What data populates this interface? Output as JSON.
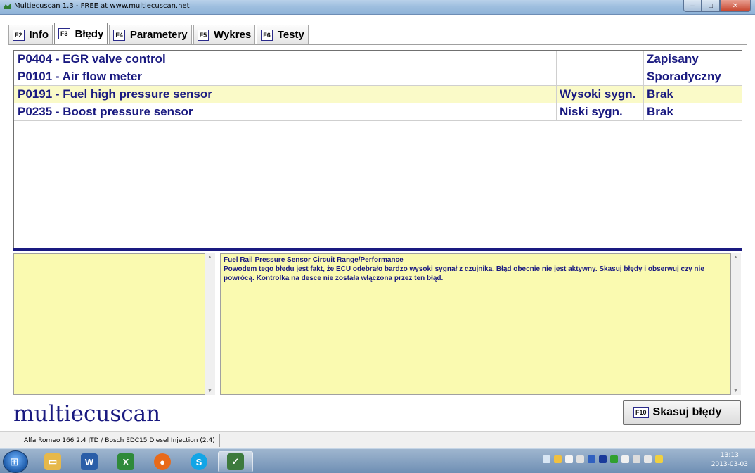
{
  "window": {
    "title": "Multiecuscan 1.3 - FREE at www.multiecuscan.net",
    "minimize": "‒",
    "maximize": "□",
    "close": "✕"
  },
  "tabs": [
    {
      "key": "F2",
      "label": "Info"
    },
    {
      "key": "F3",
      "label": "Błędy"
    },
    {
      "key": "F4",
      "label": "Parametery"
    },
    {
      "key": "F5",
      "label": "Wykres"
    },
    {
      "key": "F6",
      "label": "Testy"
    }
  ],
  "errors": [
    {
      "code": "P0404 - EGR valve control",
      "signal": "",
      "status": "Zapisany"
    },
    {
      "code": "P0101 - Air flow meter",
      "signal": "",
      "status": "Sporadyczny"
    },
    {
      "code": "P0191 - Fuel high pressure sensor",
      "signal": "Wysoki sygn.",
      "status": "Brak"
    },
    {
      "code": "P0235 - Boost pressure sensor",
      "signal": "Niski sygn.",
      "status": "Brak"
    }
  ],
  "description": {
    "title": "Fuel Rail Pressure Sensor Circuit Range/Performance",
    "body": "Powodem tego błedu jest fakt, że ECU odebrało bardzo wysoki sygnał z czujnika. Błąd obecnie nie jest aktywny. Skasuj błędy i obserwuj czy nie powrócą. Kontrolka na desce nie została włączona przez ten błąd."
  },
  "logo": "multiecuscan",
  "clear_button": {
    "key": "F10",
    "label": "Skasuj błędy"
  },
  "statusbar": {
    "vehicle": "Alfa Romeo 166 2.4 JTD / Bosch EDC15 Diesel Injection (2.4)"
  },
  "taskbar": {
    "time": "13:13",
    "date": "2013-03-03"
  },
  "colors": {
    "accent": "#1a1a80",
    "highlight": "#fafac8",
    "panel": "#fafab0"
  }
}
